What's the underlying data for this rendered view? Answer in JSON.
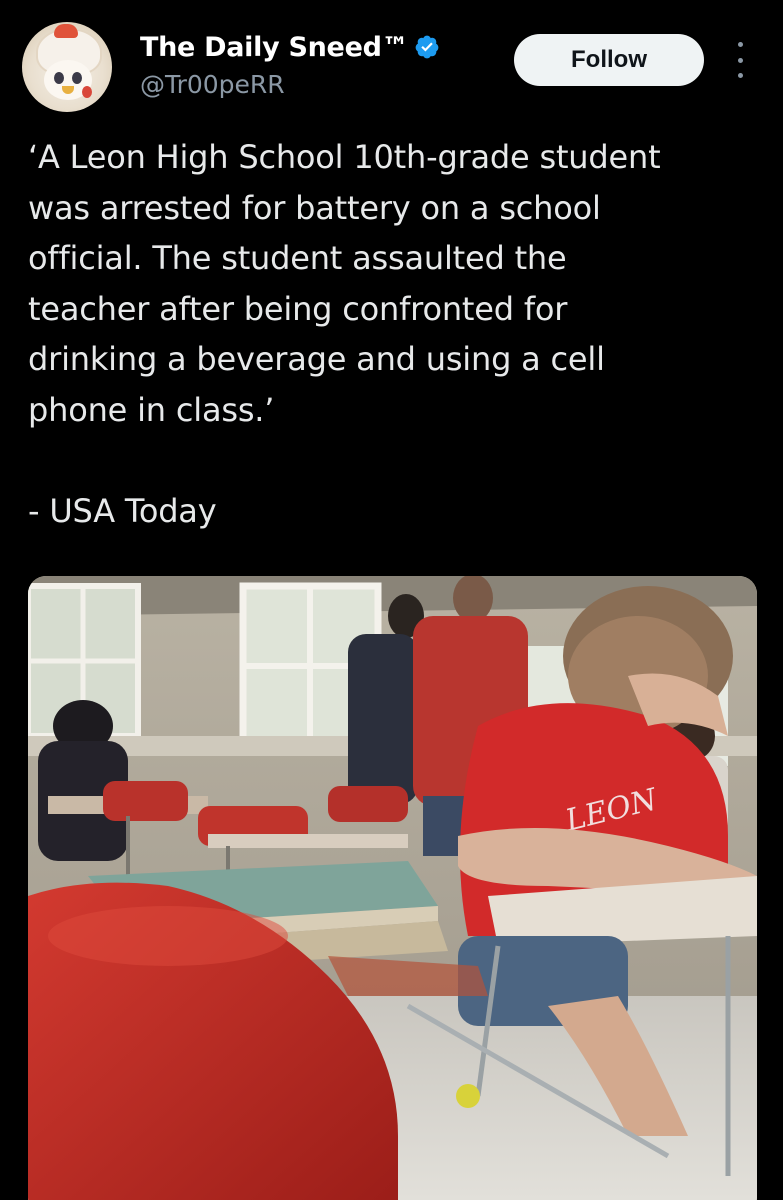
{
  "post": {
    "author": {
      "display_name": "The Daily Sneed™",
      "handle": "@Tr00peRR",
      "verified": true,
      "avatar_icon": "cat-in-chicken-costume-avatar"
    },
    "follow_label": "Follow",
    "more_icon": "more-options-icon",
    "text": "‘A Leon High School 10th-grade student\nwas arrested for battery on a school\nofficial.  The student assaulted the\nteacher after being confronted for\ndrinking a beverage and using a cell\nphone in class.’\n\n- USA Today",
    "media": {
      "type": "video-still",
      "shirt_print": "LEON"
    }
  },
  "colors": {
    "background": "#000000",
    "text_primary": "#e7e9ea",
    "text_secondary": "#8b98a5",
    "verified_badge": "#1d9bf0",
    "follow_button_bg": "#eff3f4",
    "follow_button_text": "#0f1419"
  }
}
